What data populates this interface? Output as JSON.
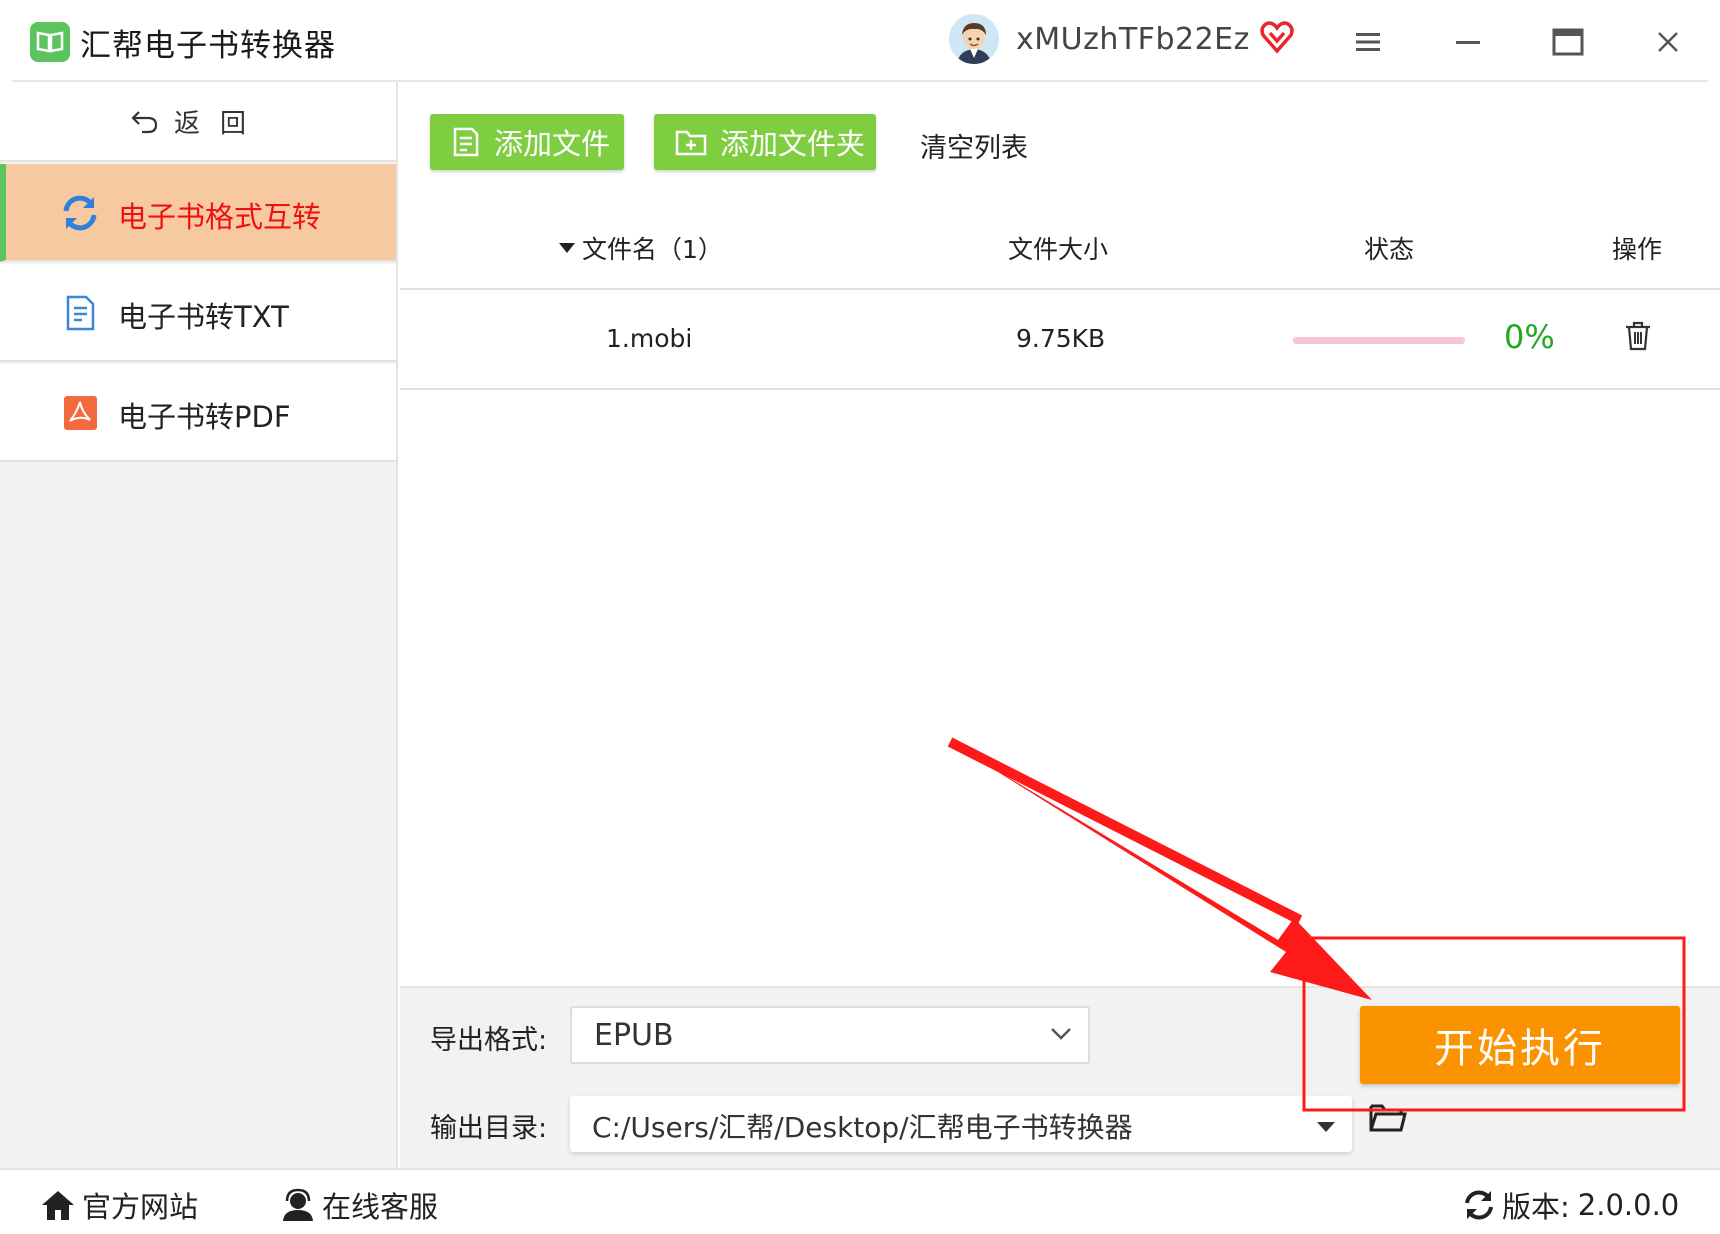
{
  "app": {
    "title": "汇帮电子书转换器",
    "username": "xMUzhTFb22Ez"
  },
  "sidebar": {
    "back_label": "返回",
    "items": [
      {
        "label": "电子书格式互转",
        "icon": "refresh-icon",
        "active": true
      },
      {
        "label": "电子书转TXT",
        "icon": "document-icon",
        "active": false
      },
      {
        "label": "电子书转PDF",
        "icon": "pdf-icon",
        "active": false
      }
    ]
  },
  "toolbar": {
    "add_file_label": "添加文件",
    "add_folder_label": "添加文件夹",
    "clear_label": "清空列表"
  },
  "table": {
    "headers": {
      "name": "文件名（1）",
      "size": "文件大小",
      "status": "状态",
      "action": "操作"
    },
    "rows": [
      {
        "name": "1.mobi",
        "size": "9.75KB",
        "progress": 0,
        "percent": "0%"
      }
    ]
  },
  "settings": {
    "format_label": "导出格式:",
    "format_value": "EPUB",
    "output_label": "输出目录:",
    "output_value": "C:/Users/汇帮/Desktop/汇帮电子书转换器",
    "start_label": "开始执行"
  },
  "footer": {
    "website_label": "官方网站",
    "support_label": "在线客服",
    "version_label": "版本:",
    "version_value": "2.0.0.0"
  },
  "colors": {
    "accent_green": "#7fcd41",
    "active_nav_bg": "#f7c9a1",
    "active_nav_text": "#ee1111",
    "start_orange": "#fb9300",
    "progress_track": "#f5c6d3",
    "percent_green": "#22a822",
    "annotation_red": "#ff1a1a"
  }
}
